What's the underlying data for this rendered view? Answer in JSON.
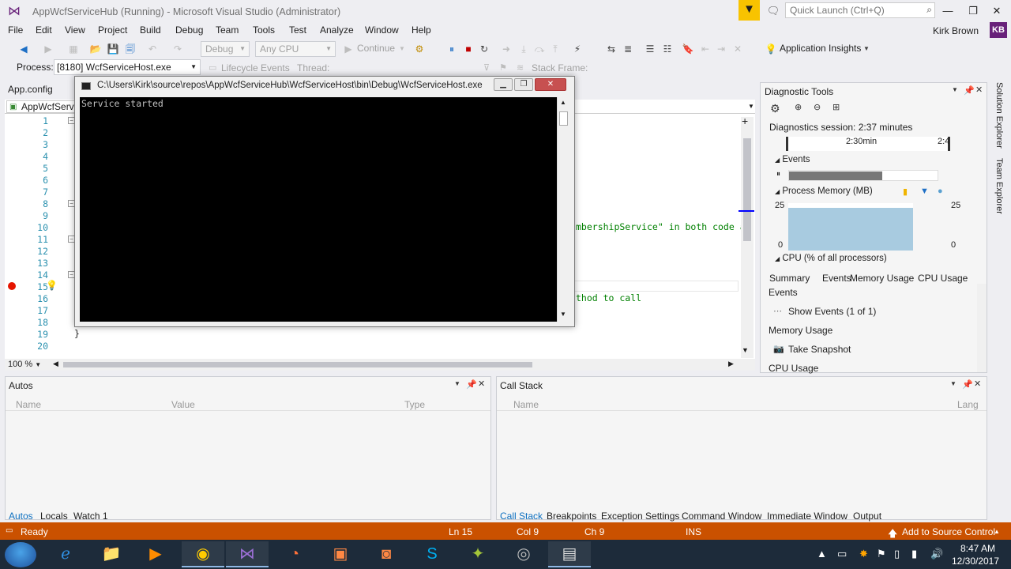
{
  "window": {
    "title": "AppWcfServiceHub (Running) - Microsoft Visual Studio  (Administrator)",
    "quick_launch_placeholder": "Quick Launch (Ctrl+Q)",
    "user": "Kirk Brown",
    "user_initials": "KB"
  },
  "menu": [
    "File",
    "Edit",
    "View",
    "Project",
    "Build",
    "Debug",
    "Team",
    "Tools",
    "Test",
    "Analyze",
    "Window",
    "Help"
  ],
  "toolbar": {
    "config": "Debug",
    "platform": "Any CPU",
    "continue": "Continue",
    "app_insights": "Application Insights"
  },
  "debug_location": {
    "process_label": "Process:",
    "process_value": "[8180] WcfServiceHost.exe",
    "lifecycle": "Lifecycle Events",
    "thread": "Thread:",
    "stack_frame": "Stack Frame:"
  },
  "documents": {
    "tab1": "App.config",
    "tab2": "AppWcfServic"
  },
  "editor": {
    "line_numbers": [
      "1",
      "2",
      "3",
      "4",
      "5",
      "6",
      "7",
      "8",
      "9",
      "10",
      "11",
      "12",
      "13",
      "14",
      "15",
      "16",
      "17",
      "18",
      "19",
      "20"
    ],
    "code_fragment_1": "mbershipService\" in both code ar",
    "code_fragment_2": "thod to call",
    "brace": "}",
    "zoom": "100 %"
  },
  "console": {
    "title": "C:\\Users\\Kirk\\source\\repos\\AppWcfServiceHub\\WcfServiceHost\\bin\\Debug\\WcfServiceHost.exe",
    "output": "Service started"
  },
  "diagnostics": {
    "title": "Diagnostic Tools",
    "session": "Diagnostics session: 2:37 minutes",
    "time_tick": "2:30min",
    "time_tick_2": "2:4",
    "events_label": "Events",
    "memory_label": "Process Memory (MB)",
    "mem_max": "25",
    "mem_min": "0",
    "cpu_label": "CPU (% of all processors)",
    "tabs": [
      "Summary",
      "Events",
      "Memory Usage",
      "CPU Usage"
    ],
    "section_events": "Events",
    "show_events": "Show Events (1 of 1)",
    "section_memory": "Memory Usage",
    "take_snapshot": "Take Snapshot",
    "section_cpu": "CPU Usage"
  },
  "side_tabs": [
    "Solution Explorer",
    "Team Explorer"
  ],
  "autos": {
    "title": "Autos",
    "col_name": "Name",
    "col_value": "Value",
    "col_type": "Type",
    "tabs": [
      "Autos",
      "Locals",
      "Watch 1"
    ]
  },
  "callstack": {
    "title": "Call Stack",
    "col_name": "Name",
    "col_lang": "Lang",
    "tabs": [
      "Call Stack",
      "Breakpoints",
      "Exception Settings",
      "Command Window",
      "Immediate Window",
      "Output"
    ]
  },
  "status": {
    "ready": "Ready",
    "ln": "Ln 15",
    "col": "Col 9",
    "ch": "Ch 9",
    "ins": "INS",
    "source_control": "Add to Source Control"
  },
  "taskbar": {
    "time": "8:47 AM",
    "date": "12/30/2017"
  },
  "colors": {
    "status_bar": "#ca5100",
    "vs_purple": "#68217a",
    "accent_blue": "#0e70c0"
  }
}
